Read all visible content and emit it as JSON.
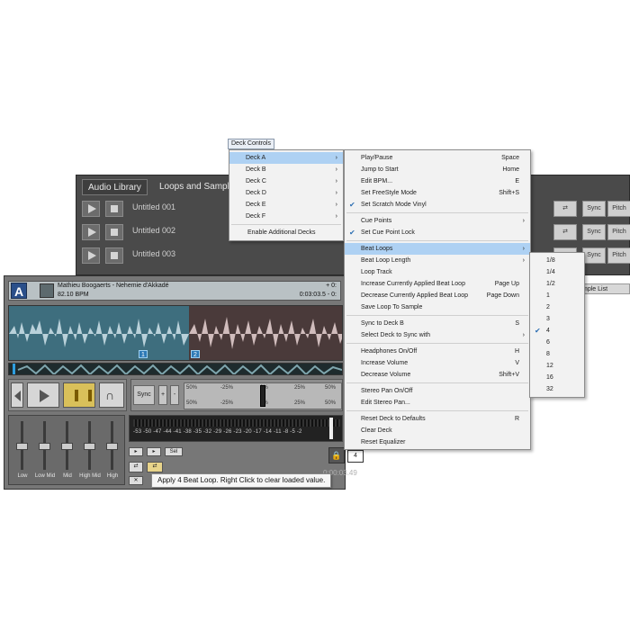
{
  "library": {
    "tabs": [
      "Audio Library",
      "Loops and Samples"
    ],
    "rows": [
      "Untitled 001",
      "Untitled 002",
      "Untitled 003"
    ],
    "sync_label": "Sync",
    "pitch_label": "Pitch",
    "sample_list_tab": "mple List"
  },
  "deck": {
    "letter": "A",
    "track": "Mathieu Boogaerts - Nehemie d'Akkadé",
    "bpm": "82.10 BPM",
    "plus": "+ 0:",
    "time": "0:03:03.5 - 0:",
    "cue_1": "1",
    "cue_2": "2",
    "sync_label": "Sync",
    "pitch_plus": "+",
    "pitch_minus": "-",
    "pitch_scale_top": [
      "50%",
      "-25%",
      "0%",
      "25%",
      "50%"
    ],
    "pitch_scale_bottom": [
      "50%",
      "-25%",
      "0%",
      "25%",
      "50%"
    ],
    "eq_labels": [
      "Low",
      "Low Mid",
      "Mid",
      "High Mid",
      "High"
    ],
    "meter_scale": "-53 -50 -47 -44 -41 -38 -35 -32 -29 -26 -23 -20 -17 -14 -11 -8 -5 -2",
    "sel_label": "Sel",
    "loop_count": "4",
    "clock": "0:00:03.49",
    "x_label": "✕"
  },
  "tooltip": "Apply 4 Beat Loop. Right Click to clear loaded value.",
  "menus": {
    "title": "Deck Controls",
    "decks": [
      {
        "label": "Deck A",
        "highlight": true
      },
      {
        "label": "Deck B"
      },
      {
        "label": "Deck C"
      },
      {
        "label": "Deck D"
      },
      {
        "label": "Deck E"
      },
      {
        "label": "Deck F"
      },
      {
        "label": "Enable Additional Decks"
      }
    ],
    "deck_a": [
      {
        "label": "Play/Pause",
        "key": "Space"
      },
      {
        "label": "Jump to Start",
        "key": "Home"
      },
      {
        "label": "Edit BPM...",
        "key": "E"
      },
      {
        "label": "Set FreeStyle Mode",
        "key": "Shift+S"
      },
      {
        "label": "Set Scratch Mode Vinyl",
        "checked": true
      },
      {
        "label": "Cue Points",
        "submenu": true
      },
      {
        "label": "Set Cue Point Lock",
        "checked": true
      },
      {
        "label": "Beat Loops",
        "submenu": true,
        "highlight": true
      },
      {
        "label": "Beat Loop Length",
        "submenu": true
      },
      {
        "label": "Loop Track"
      },
      {
        "label": "Increase Currently Applied Beat Loop",
        "key": "Page Up"
      },
      {
        "label": "Decrease Currently Applied Beat Loop",
        "key": "Page Down"
      },
      {
        "label": "Save Loop To Sample"
      },
      {
        "label": "Sync to Deck B",
        "key": "S"
      },
      {
        "label": "Select Deck to Sync with",
        "submenu": true
      },
      {
        "label": "Headphones On/Off",
        "key": "H"
      },
      {
        "label": "Increase Volume",
        "key": "V"
      },
      {
        "label": "Decrease Volume",
        "key": "Shift+V"
      },
      {
        "label": "Stereo Pan On/Off"
      },
      {
        "label": "Edit Stereo Pan..."
      },
      {
        "label": "Reset Deck to Defaults",
        "key": "R"
      },
      {
        "label": "Clear Deck"
      },
      {
        "label": "Reset Equalizer"
      }
    ],
    "beat_loops": [
      {
        "label": "1/8"
      },
      {
        "label": "1/4"
      },
      {
        "label": "1/2"
      },
      {
        "label": "1"
      },
      {
        "label": "2"
      },
      {
        "label": "3"
      },
      {
        "label": "4",
        "checked": true
      },
      {
        "label": "6"
      },
      {
        "label": "8"
      },
      {
        "label": "12"
      },
      {
        "label": "16"
      },
      {
        "label": "32"
      }
    ]
  }
}
